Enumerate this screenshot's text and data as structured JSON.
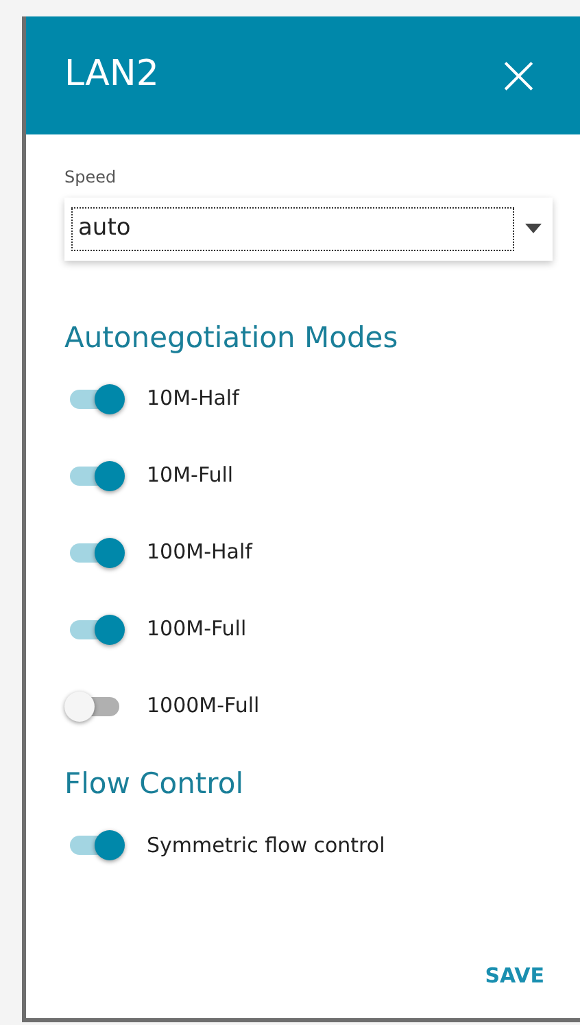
{
  "dialog": {
    "title": "LAN2",
    "close": "×"
  },
  "speed": {
    "label": "Speed",
    "value": "auto"
  },
  "sections": [
    {
      "title": "Autonegotiation Modes",
      "switches": [
        {
          "label": "10M-Half",
          "on": true
        },
        {
          "label": "10M-Full",
          "on": true
        },
        {
          "label": "100M-Half",
          "on": true
        },
        {
          "label": "100M-Full",
          "on": true
        },
        {
          "label": "1000M-Full",
          "on": false
        }
      ]
    },
    {
      "title": "Flow Control",
      "switches": [
        {
          "label": "Symmetric flow control",
          "on": true
        }
      ]
    }
  ],
  "buttons": [
    {
      "label": "SAVE"
    }
  ]
}
